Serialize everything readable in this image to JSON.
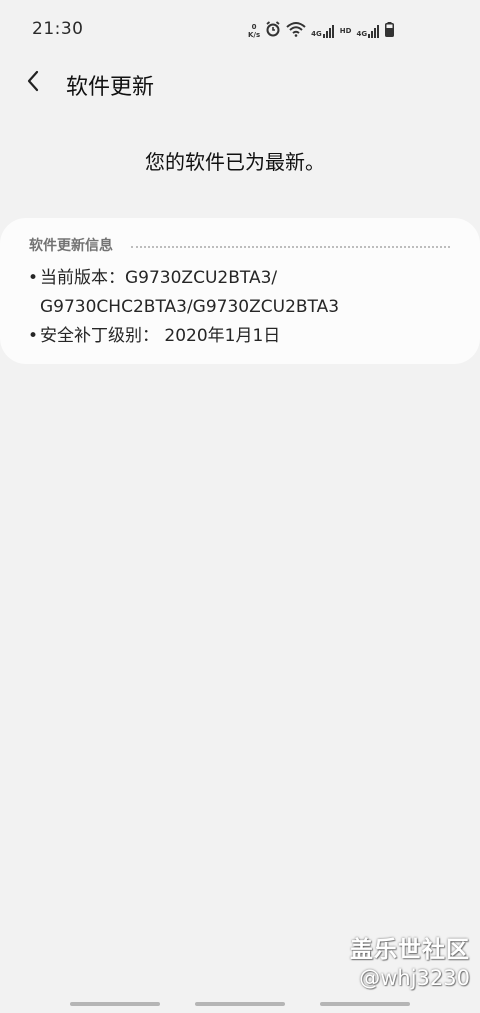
{
  "status_bar": {
    "time": "21:30",
    "speed_value": "0",
    "speed_unit": "K/s",
    "network_1": "4G",
    "hd_label": "HD",
    "network_2": "4G"
  },
  "header": {
    "title": "软件更新",
    "back_icon": "chevron-left-icon"
  },
  "main": {
    "status_message": "您的软件已为最新。"
  },
  "info_card": {
    "title": "软件更新信息",
    "items": [
      {
        "bullet": "•",
        "text": "当前版本：G9730ZCU2BTA3/ G9730CHC2BTA3/G9730ZCU2BTA3"
      },
      {
        "bullet": "•",
        "text": "安全补丁级别： 2020年1月1日"
      }
    ]
  },
  "watermark": {
    "logo": "盖乐世社区",
    "user": "@whj3230"
  },
  "colors": {
    "background": "#f2f2f2",
    "card": "#fcfcfc",
    "card_title": "#737373"
  }
}
